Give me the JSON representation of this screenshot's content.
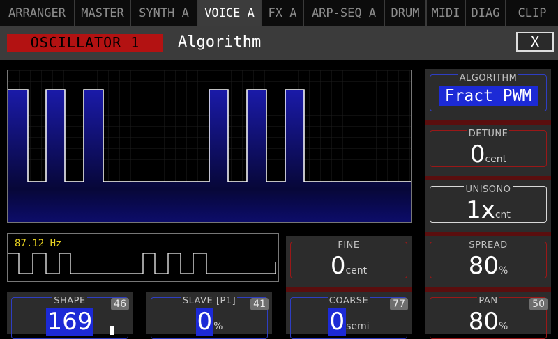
{
  "tabs": [
    {
      "label": "ARRANGER",
      "active": false
    },
    {
      "label": "MASTER",
      "active": false
    },
    {
      "label": "SYNTH A",
      "active": false
    },
    {
      "label": "VOICE A",
      "active": true
    },
    {
      "label": "FX A",
      "active": false
    },
    {
      "label": "ARP-SEQ A",
      "active": false
    },
    {
      "label": "DRUM",
      "active": false
    },
    {
      "label": "MIDI",
      "active": false
    },
    {
      "label": "DIAG",
      "active": false
    },
    {
      "label": "CLIP",
      "active": false
    }
  ],
  "header": {
    "section": "OSCILLATOR 1",
    "title": "Algorithm",
    "close_label": "X"
  },
  "scope": {
    "frequency": "87.12 Hz"
  },
  "params": {
    "algorithm": {
      "label": "ALGORITHM",
      "value": "Fract PWM"
    },
    "detune": {
      "label": "DETUNE",
      "value": "0",
      "unit": "cent"
    },
    "unisono": {
      "label": "UNISONO",
      "value": "1x",
      "unit": "cnt"
    },
    "spread": {
      "label": "SPREAD",
      "value": "80",
      "unit": "%"
    },
    "pan": {
      "label": "PAN",
      "value": "80",
      "unit": "%",
      "badge": "50"
    },
    "fine": {
      "label": "FINE",
      "value": "0",
      "unit": "cent"
    },
    "coarse": {
      "label": "COARSE",
      "value": "0",
      "unit": "semi",
      "badge": "77"
    },
    "shape": {
      "label": "SHAPE",
      "value": "169",
      "badge": "46"
    },
    "slave": {
      "label": "SLAVE [P1]",
      "value": "0",
      "unit": "%",
      "badge": "41"
    }
  },
  "colors": {
    "accent_red": "#b31212",
    "accent_blue": "#1c2ad6",
    "scope_text": "#e6d020"
  }
}
